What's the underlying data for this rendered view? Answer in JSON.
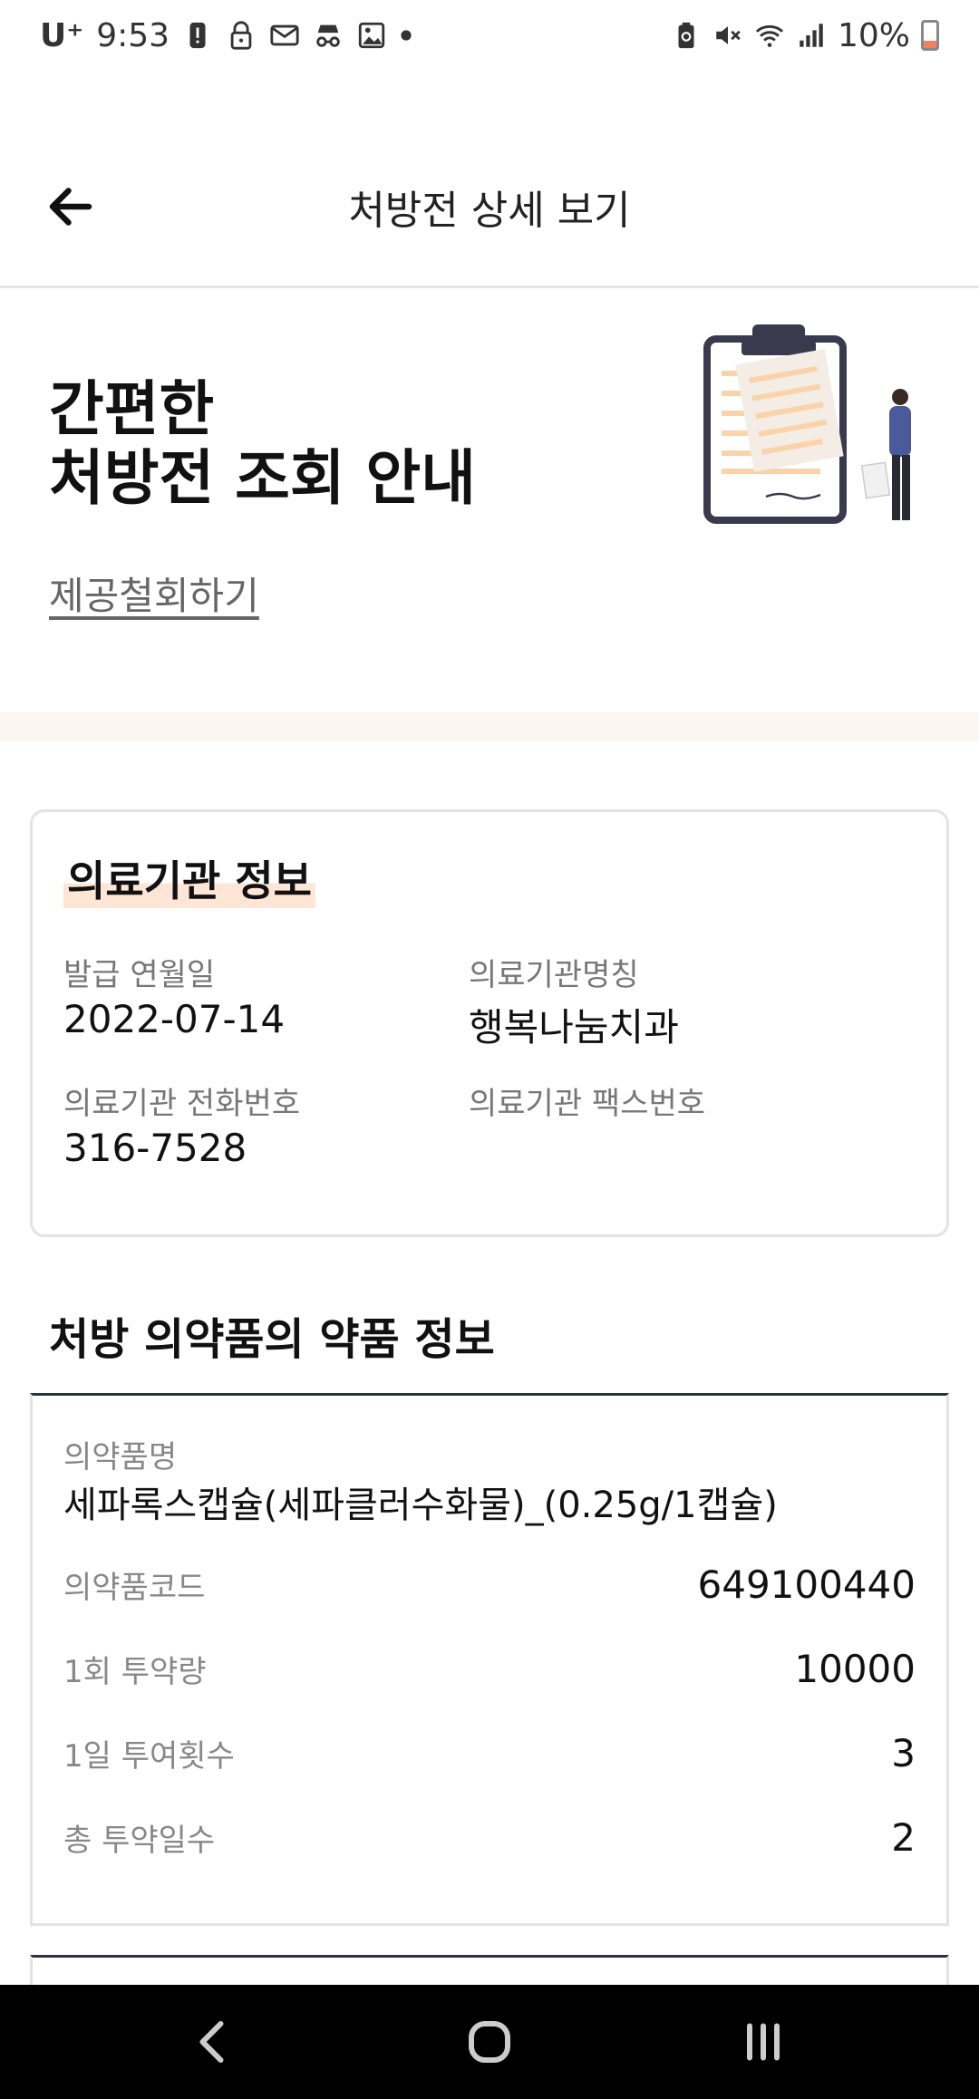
{
  "status_bar": {
    "carrier": "U⁺",
    "time": "9:53",
    "battery_percent": "10%",
    "left_icons": [
      "alert-icon",
      "lock-icon",
      "mail-icon",
      "incognito-icon",
      "image-icon",
      "dot-icon"
    ],
    "right_icons": [
      "battery-saver-icon",
      "mute-icon",
      "wifi-icon",
      "signal-icon",
      "battery-icon"
    ]
  },
  "header": {
    "title": "처방전 상세 보기",
    "back_icon": "arrow-left-icon"
  },
  "hero": {
    "title_line1": "간편한",
    "title_line2": "처방전 조회 안내",
    "withdraw_link": "제공철회하기",
    "accent_color": "#fbd3aa"
  },
  "facility": {
    "title": "의료기관 정보",
    "issue_date_label": "발급 연월일",
    "issue_date": "2022-07-14",
    "name_label": "의료기관명칭",
    "name": "행복나눔치과",
    "phone_label": "의료기관 전화번호",
    "phone": "316-7528",
    "fax_label": "의료기관 팩스번호",
    "fax": ""
  },
  "medicine": {
    "section_title": "처방 의약품의 약품 정보",
    "name_label": "의약품명",
    "name": "세파록스캡슐(세파클러수화물)_(0.25g/1캡슐)",
    "rows": [
      {
        "label": "의약품코드",
        "value": "649100440"
      },
      {
        "label": "1회 투약량",
        "value": "10000"
      },
      {
        "label": "1일 투여횟수",
        "value": "3"
      },
      {
        "label": "총 투약일수",
        "value": "2"
      }
    ]
  },
  "nav_bar": {
    "icons": [
      "back-nav-icon",
      "home-nav-icon",
      "recents-nav-icon"
    ]
  }
}
